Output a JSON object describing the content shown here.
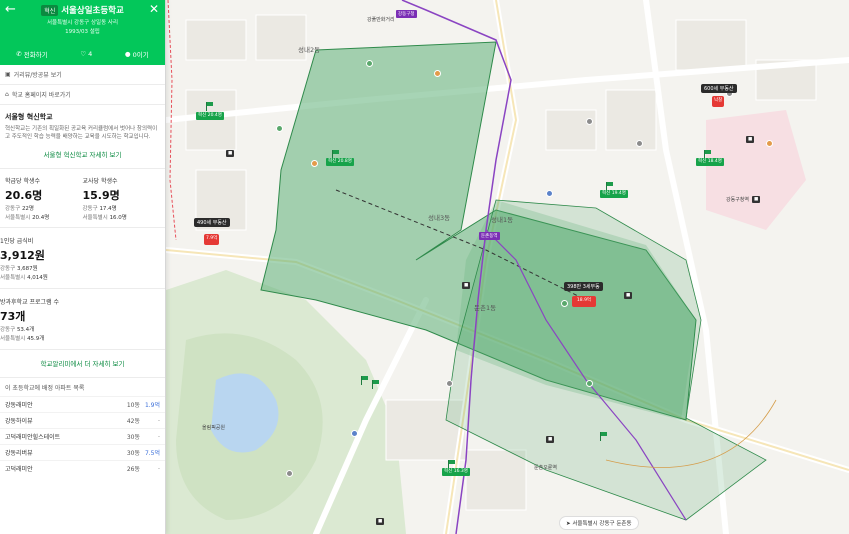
{
  "panel": {
    "header": {
      "back_icon": "arrow-left-icon",
      "close_icon": "close-icon",
      "badge": "혁신",
      "title": "서울상일초등학교",
      "address": "서울특별시 강동구 상일동 사리",
      "opened": "1993/03 설립",
      "call_label": "전화하기",
      "like_count": "4",
      "share_label": "0이기"
    },
    "links": {
      "directions": "거리뷰/방공뷰 보기",
      "homepage": "학교 홈페이지 바로가기"
    },
    "intro": {
      "title": "서울형 혁신학교",
      "text": "혁신학교는 기존의 획일화된 공교육 커리큘럼에서 벗어나 창의력이고 주도적인 학습 능력을 배양하는 교육을 시도하는 학교입니다.",
      "more_link": "서울형 혁신학교 자세히 보기"
    },
    "stats": {
      "students_per_class": {
        "label": "학급당 학생수",
        "value": "20.6명",
        "sub1_label": "강동구",
        "sub1_value": "22명",
        "sub2_label": "서울특별시",
        "sub2_value": "20.4명"
      },
      "students_per_teacher": {
        "label": "교사당 학생수",
        "value": "15.9명",
        "sub1_label": "강동구",
        "sub1_value": "17.4명",
        "sub2_label": "서울특별시",
        "sub2_value": "16.0명"
      },
      "meal_cost": {
        "label": "1인당 급식비",
        "value": "3,912원",
        "sub1_label": "강동구",
        "sub1_value": "3,687원",
        "sub2_label": "서울특별시",
        "sub2_value": "4,014원"
      },
      "after_school": {
        "label": "방과후학교 프로그램 수",
        "value": "73개",
        "sub1_label": "강동구",
        "sub1_value": "53.4개",
        "sub2_label": "서울특별시",
        "sub2_value": "45.9개"
      }
    },
    "school_info_link": "학교알리미에서 더 자세히 보기",
    "nearby": {
      "heading": "이 초등학교에 배정 아파트 목록",
      "rows": [
        {
          "name": "강동래미안",
          "count": "10동",
          "price": "1.9억"
        },
        {
          "name": "강동하이뷰",
          "count": "42동",
          "price": "-"
        },
        {
          "name": "고덕래미안힐스테이트",
          "count": "30동",
          "price": "-"
        },
        {
          "name": "강동리버뷰",
          "count": "30동",
          "price": "7.5억"
        },
        {
          "name": "고덕래미안",
          "count": "26동",
          "price": "-"
        }
      ]
    }
  },
  "map": {
    "colors": {
      "zone_fill": "#5fb078",
      "zone_stroke": "#2f8a4b",
      "subway_purple": "#8a44c2",
      "park_green": "#dbe9d2"
    },
    "area_labels": [
      "성내2동",
      "성내1동",
      "둔촌1동",
      "성내3동",
      "강풀만화거리",
      "강동구청역",
      "둔촌오륜역",
      "올림픽공원"
    ],
    "price_bubbles": [
      "600세 부동산",
      "398만 3세부동",
      "490세 부동산"
    ],
    "red_pins": [
      "18.9억",
      "낙찰",
      "7.9억"
    ],
    "green_flags": [
      "혁신 20.4명",
      "혁신 18.4명",
      "혁신 20.8명",
      "혁신 16.3명",
      "혁신 19.4명"
    ],
    "stations": [
      "둔촌동역",
      "강동구청"
    ],
    "bottom_chip": "서울특별시 강동구 둔촌동",
    "scale": "200m"
  }
}
